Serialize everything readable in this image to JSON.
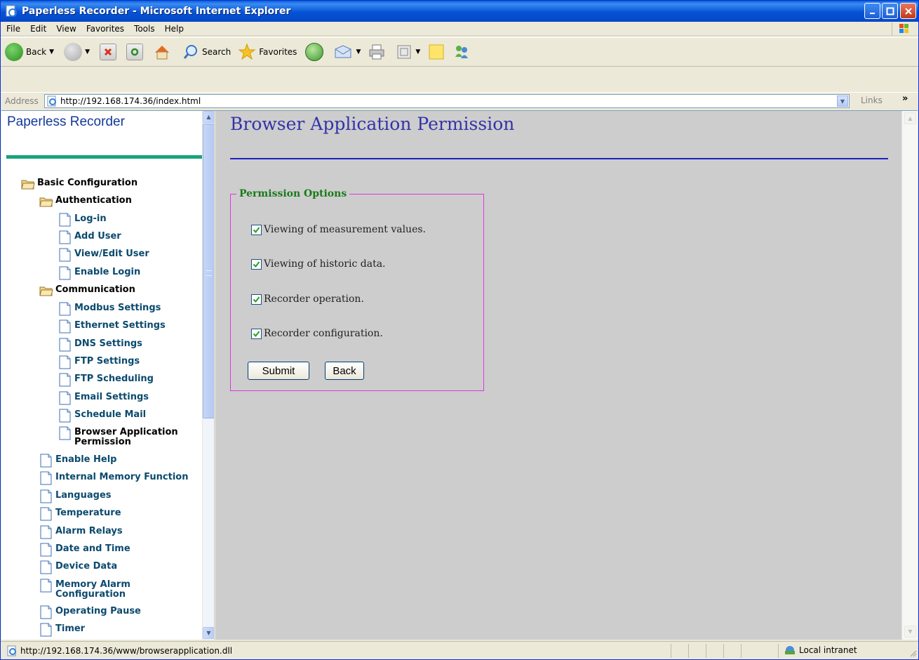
{
  "window": {
    "title": "Paperless Recorder - Microsoft Internet Explorer"
  },
  "menu": [
    "File",
    "Edit",
    "View",
    "Favorites",
    "Tools",
    "Help"
  ],
  "toolbar": {
    "back_label": "Back",
    "search_label": "Search",
    "favorites_label": "Favorites"
  },
  "address": {
    "label": "Address",
    "url": "http://192.168.174.36/index.html",
    "links_label": "Links",
    "links_arrow": "»"
  },
  "nav": {
    "title": "Paperless Recorder",
    "items": [
      {
        "label": "Basic Configuration",
        "type": "folder"
      },
      {
        "label": "Authentication",
        "type": "folder"
      },
      {
        "label": "Log-in",
        "type": "page"
      },
      {
        "label": "Add User",
        "type": "page"
      },
      {
        "label": "View/Edit User",
        "type": "page"
      },
      {
        "label": "Enable Login",
        "type": "page"
      },
      {
        "label": "Communication",
        "type": "folder"
      },
      {
        "label": "Modbus Settings",
        "type": "page"
      },
      {
        "label": "Ethernet Settings",
        "type": "page"
      },
      {
        "label": "DNS Settings",
        "type": "page"
      },
      {
        "label": "FTP Settings",
        "type": "page"
      },
      {
        "label": "FTP Scheduling",
        "type": "page"
      },
      {
        "label": "Email Settings",
        "type": "page"
      },
      {
        "label": "Schedule Mail",
        "type": "page"
      },
      {
        "label": "Browser Application Permission",
        "type": "page",
        "current": true
      },
      {
        "label": "Enable Help",
        "type": "page"
      },
      {
        "label": "Internal Memory Function",
        "type": "page"
      },
      {
        "label": "Languages",
        "type": "page"
      },
      {
        "label": "Temperature",
        "type": "page"
      },
      {
        "label": "Alarm Relays",
        "type": "page"
      },
      {
        "label": "Date and Time",
        "type": "page"
      },
      {
        "label": "Device Data",
        "type": "page"
      },
      {
        "label": "Memory Alarm Configuration",
        "type": "page"
      },
      {
        "label": "Operating Pause",
        "type": "page"
      },
      {
        "label": "Timer",
        "type": "page"
      }
    ]
  },
  "main": {
    "title": "Browser Application Permission",
    "legend": "Permission Options",
    "options": [
      {
        "label": "Viewing of measurement values.",
        "checked": true
      },
      {
        "label": "Viewing of historic data.",
        "checked": true
      },
      {
        "label": "Recorder operation.",
        "checked": true
      },
      {
        "label": "Recorder configuration.",
        "checked": true
      }
    ],
    "submit_label": "Submit",
    "back_label": "Back"
  },
  "status": {
    "text": "http://192.168.174.36/www/browserapplication.dll",
    "zone": "Local intranet"
  },
  "colors": {
    "title_bar": "#0553d6",
    "nav_link": "#0b4a6e",
    "page_title": "#3333aa",
    "fieldset_border": "#e433e4",
    "legend": "#1a7a1a",
    "rule_green": "#17a37a"
  }
}
